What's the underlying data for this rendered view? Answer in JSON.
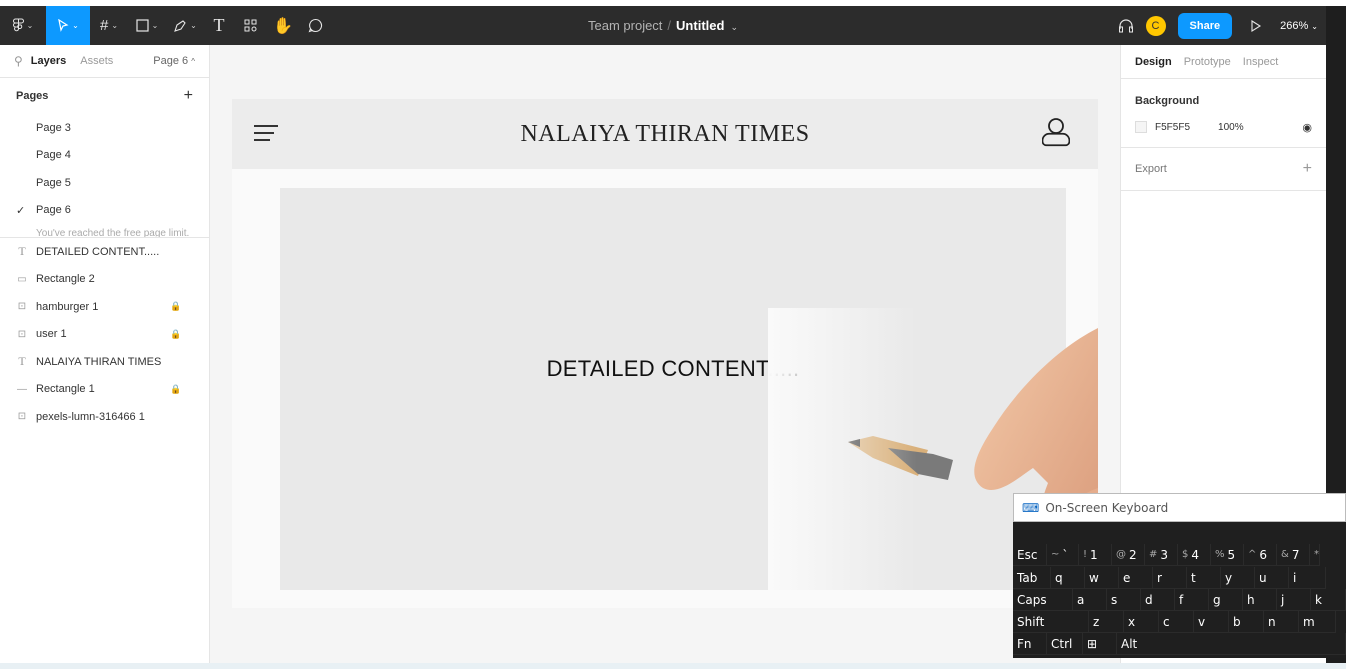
{
  "toolbar": {
    "tools": [
      "main-menu",
      "move",
      "frame",
      "shape",
      "pen",
      "text",
      "resources",
      "hand",
      "comment"
    ],
    "team": "Team project",
    "separator": "/",
    "file": "Untitled",
    "avatar_initial": "C",
    "share_label": "Share",
    "zoom": "266%"
  },
  "left_panel": {
    "tabs": {
      "layers": "Layers",
      "assets": "Assets",
      "current_page": "Page 6"
    },
    "pages_title": "Pages",
    "pages": [
      {
        "label": "Page 3",
        "checked": false
      },
      {
        "label": "Page 4",
        "checked": false
      },
      {
        "label": "Page 5",
        "checked": false
      },
      {
        "label": "Page 6",
        "checked": true
      }
    ],
    "limit_note": "You've reached the free page limit.",
    "layers": [
      {
        "label": "DETAILED CONTENT.....",
        "icon": "text",
        "locked": false
      },
      {
        "label": "Rectangle 2",
        "icon": "rectangle",
        "locked": false
      },
      {
        "label": "hamburger 1",
        "icon": "image",
        "locked": true
      },
      {
        "label": "user 1",
        "icon": "image",
        "locked": true
      },
      {
        "label": "NALAIYA THIRAN TIMES",
        "icon": "text",
        "locked": false
      },
      {
        "label": "Rectangle 1",
        "icon": "line",
        "locked": true
      },
      {
        "label": "pexels-lumn-316466 1",
        "icon": "image",
        "locked": false
      }
    ]
  },
  "canvas": {
    "site_title": "NALAIYA THIRAN TIMES",
    "content_text": "DETAILED CONTENT....."
  },
  "right_panel": {
    "tabs": {
      "design": "Design",
      "prototype": "Prototype",
      "inspect": "Inspect"
    },
    "background_title": "Background",
    "bg_hex": "F5F5F5",
    "bg_opacity": "100%",
    "export_title": "Export"
  },
  "osk": {
    "title": "On-Screen Keyboard",
    "rows": [
      [
        {
          "k": "Esc"
        },
        {
          "s": "~",
          "k": "`"
        },
        {
          "s": "!",
          "k": "1"
        },
        {
          "s": "@",
          "k": "2"
        },
        {
          "s": "#",
          "k": "3"
        },
        {
          "s": "$",
          "k": "4"
        },
        {
          "s": "%",
          "k": "5"
        },
        {
          "s": "^",
          "k": "6"
        },
        {
          "s": "&",
          "k": "7"
        },
        {
          "s": "*",
          "k": ""
        }
      ],
      [
        {
          "k": "Tab"
        },
        {
          "k": "q"
        },
        {
          "k": "w"
        },
        {
          "k": "e"
        },
        {
          "k": "r"
        },
        {
          "k": "t"
        },
        {
          "k": "y"
        },
        {
          "k": "u"
        },
        {
          "k": "i"
        }
      ],
      [
        {
          "k": "Caps"
        },
        {
          "k": "a"
        },
        {
          "k": "s"
        },
        {
          "k": "d"
        },
        {
          "k": "f"
        },
        {
          "k": "g"
        },
        {
          "k": "h"
        },
        {
          "k": "j"
        },
        {
          "k": "k"
        }
      ],
      [
        {
          "k": "Shift"
        },
        {
          "k": "z"
        },
        {
          "k": "x"
        },
        {
          "k": "c"
        },
        {
          "k": "v"
        },
        {
          "k": "b"
        },
        {
          "k": "n"
        },
        {
          "k": "m"
        }
      ],
      [
        {
          "k": "Fn"
        },
        {
          "k": "Ctrl"
        },
        {
          "k": "win"
        },
        {
          "k": "Alt"
        }
      ]
    ]
  },
  "colors": {
    "accent": "#0d99ff",
    "toolbar_bg": "#2c2c2c",
    "avatar": "#ffc700",
    "canvas_bg": "#f5f5f5"
  }
}
